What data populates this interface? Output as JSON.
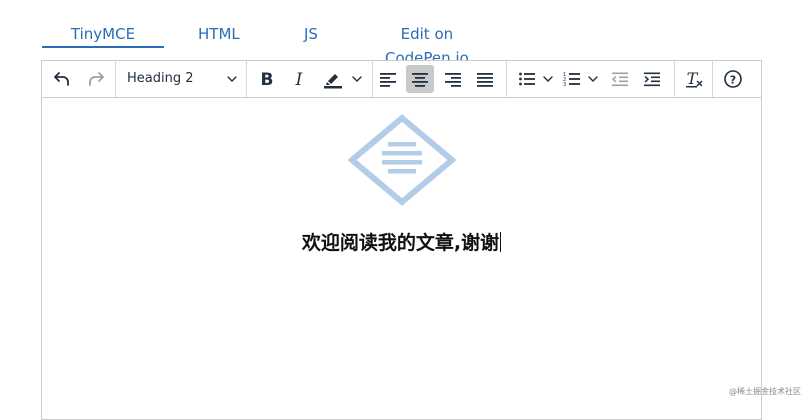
{
  "tabs": [
    {
      "label": "TinyMCE",
      "active": true
    },
    {
      "label": "HTML"
    },
    {
      "label": "JS"
    },
    {
      "label": "Edit on CodePen.io"
    }
  ],
  "toolbar": {
    "block_format": "Heading 2",
    "buttons": [
      "undo-icon",
      "redo-icon",
      "bold-icon",
      "italic-icon",
      "highlight-icon",
      "align-left-icon",
      "align-center-icon",
      "align-right-icon",
      "align-justify-icon",
      "bullet-list-icon",
      "numbered-list-icon",
      "outdent-icon",
      "indent-icon",
      "clear-formatting-icon",
      "help-icon"
    ],
    "active_alignment": "center"
  },
  "content": {
    "heading": "欢迎阅读我的文章,谢谢"
  },
  "watermark": "@稀土掘金技术社区",
  "colors": {
    "accent": "#2a6cb7",
    "logo": "#b3cde9",
    "icon": "#222f3e"
  }
}
